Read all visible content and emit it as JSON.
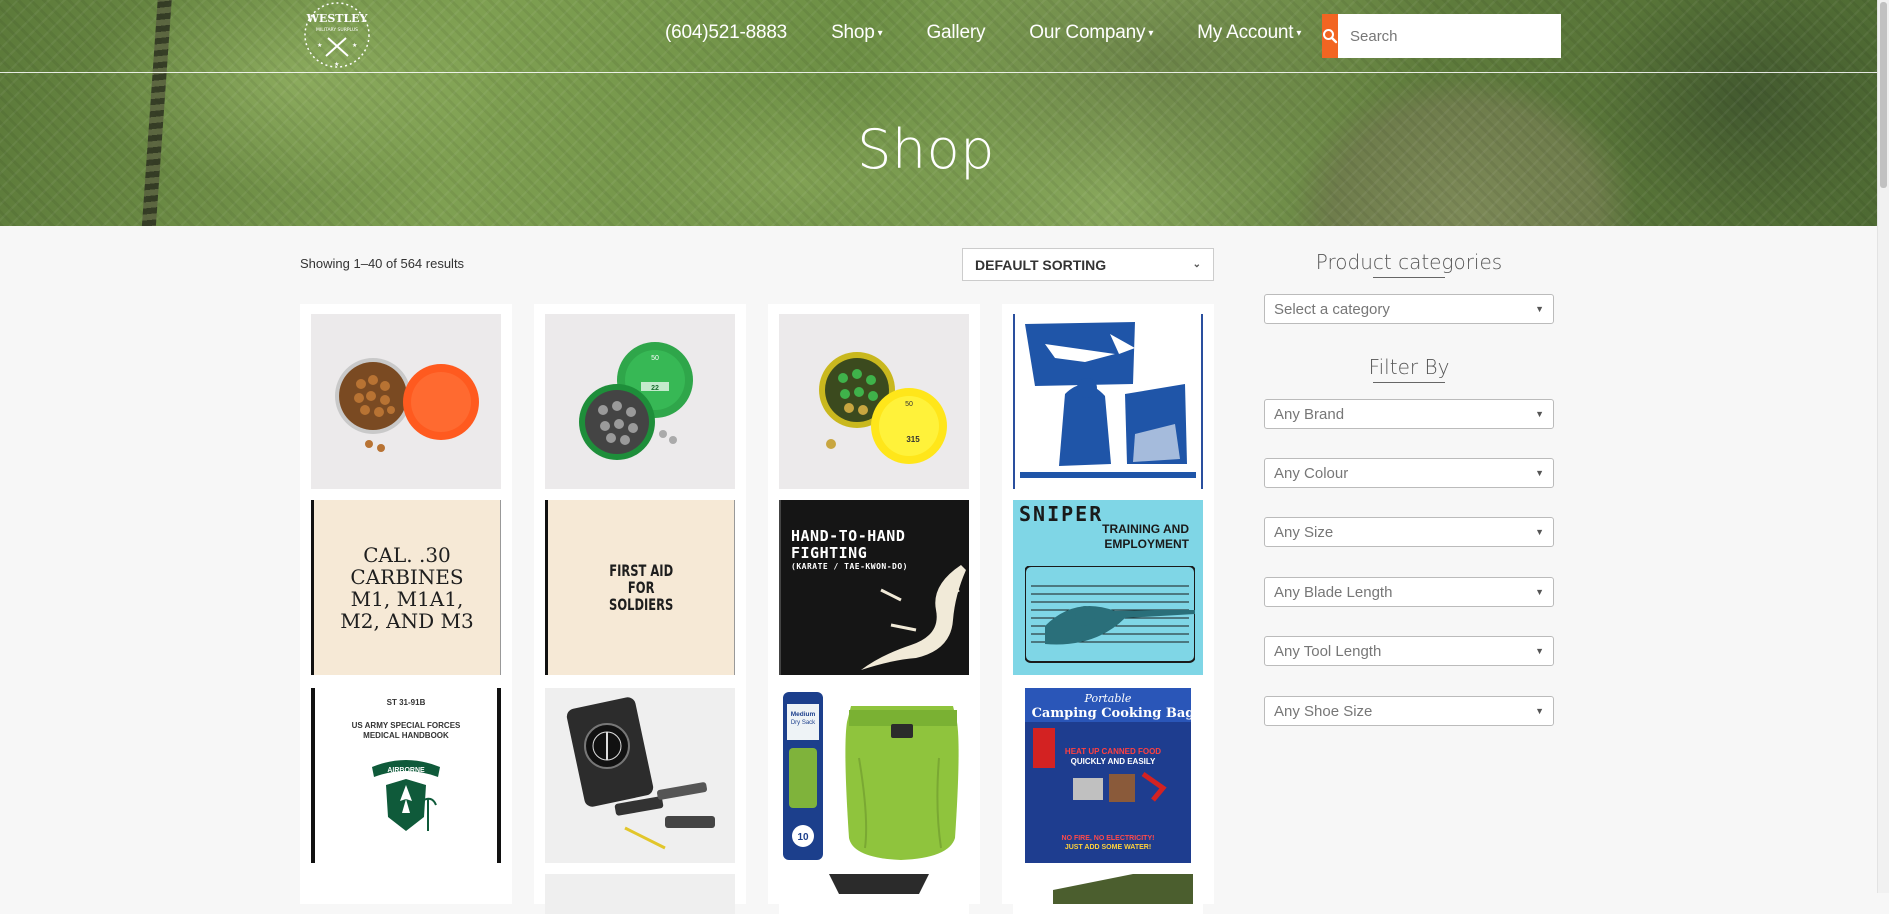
{
  "header": {
    "logo_text": "WESTLEY",
    "logo_subtext": "MILITARY SURPLUS",
    "nav": [
      {
        "label": "(604)521-8883",
        "has_caret": false
      },
      {
        "label": "Shop",
        "has_caret": true
      },
      {
        "label": "Gallery",
        "has_caret": false
      },
      {
        "label": "Our Company",
        "has_caret": true
      },
      {
        "label": "My Account",
        "has_caret": true
      }
    ],
    "search_placeholder": "Search",
    "accent_color": "#f26522"
  },
  "hero": {
    "title": "Shop"
  },
  "shop": {
    "result_count": "Showing 1–40 of 564 results",
    "sorting": "DEFAULT SORTING",
    "products": {
      "tin_labels": [
        "50",
        "22",
        "315"
      ],
      "book_carbines": "CAL. .30 CARBINES M1, M1A1, M2, AND M3",
      "book_carbines_lines": [
        "CAL. .30",
        "CARBINES",
        "M1, M1A1,",
        "M2, AND M3"
      ],
      "book_first_aid_lines": [
        "FIRST AID",
        "FOR",
        "SOLDIERS"
      ],
      "book_hth_lines": [
        "HAND-TO-HAND",
        "FIGHTING",
        "(KARATE / TAE-KWON-DO)"
      ],
      "book_sniper_title": "SNIPER",
      "book_sniper_subtitle_lines": [
        "TRAINING AND",
        "EMPLOYMENT"
      ],
      "book_sf_code": "ST 31-91B",
      "book_sf_title_lines": [
        "US ARMY SPECIAL FORCES",
        "MEDICAL HANDBOOK"
      ],
      "book_sf_badge": "AIRBORNE",
      "drysack_label_lines": [
        "Medium",
        "Dry Sack"
      ],
      "drysack_capacity": "10",
      "cookbag_title_lines": [
        "Portable",
        "Camping Cooking Bag"
      ],
      "cookbag_tagline_lines": [
        "HEAT UP CANNED FOOD",
        "QUICKLY AND EASILY"
      ],
      "cookbag_footer_lines": [
        "NO FIRE, NO ELECTRICITY!",
        "JUST ADD SOME WATER!"
      ]
    }
  },
  "sidebar": {
    "categories_heading": "Product categories",
    "category_select": "Select a category",
    "filter_heading": "Filter By",
    "filters": [
      "Any Brand",
      "Any Colour",
      "Any Size",
      "Any Blade Length",
      "Any Tool Length",
      "Any Shoe Size"
    ]
  }
}
